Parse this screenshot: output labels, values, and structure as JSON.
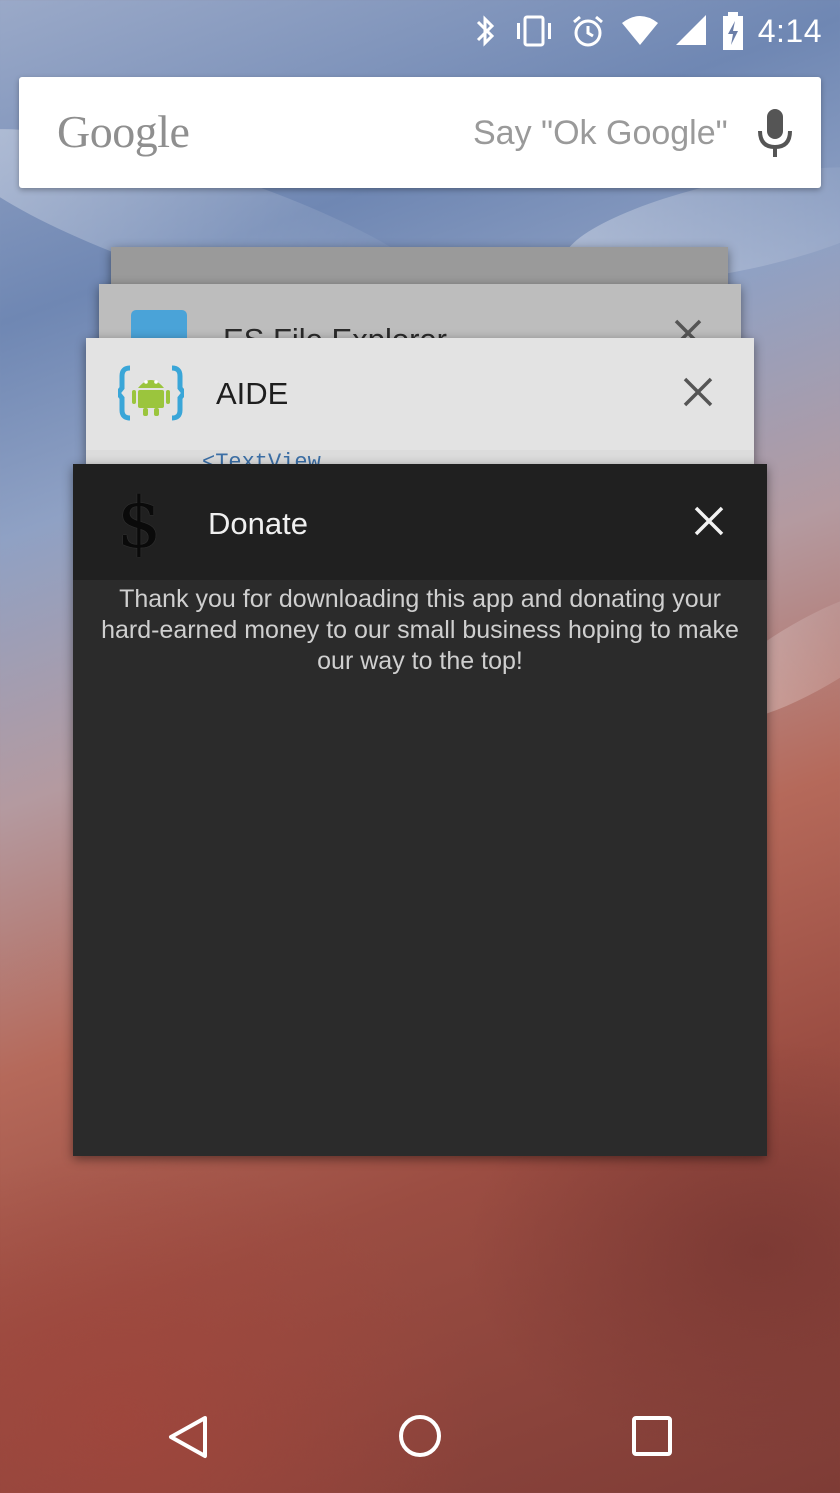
{
  "status_bar": {
    "time": "4:14",
    "icons": [
      "bluetooth-icon",
      "vibrate-icon",
      "alarm-icon",
      "wifi-icon",
      "signal-icon",
      "battery-charging-icon"
    ]
  },
  "search": {
    "logo": "Google",
    "hint": "Say \"Ok Google\"",
    "icon": "mic-icon"
  },
  "recents": {
    "cards": [
      {
        "title": "",
        "icon": "app-icon"
      },
      {
        "title": "ES File Explorer",
        "icon": "folder-icon"
      },
      {
        "title": "AIDE",
        "icon": "android-icon",
        "preview": "<TextView"
      },
      {
        "title": "Donate",
        "icon": "dollar-icon",
        "symbol": "$",
        "message": "Thank you for downloading this app and donating your hard-earned money to our small business hoping to make our way to the top!"
      }
    ]
  },
  "nav": {
    "back": "back-icon",
    "home": "home-icon",
    "recents": "recents-icon"
  },
  "colors": {
    "card_dark": "#2b2b2b",
    "card_header_dark": "#202020",
    "search_bg": "#ffffff"
  }
}
